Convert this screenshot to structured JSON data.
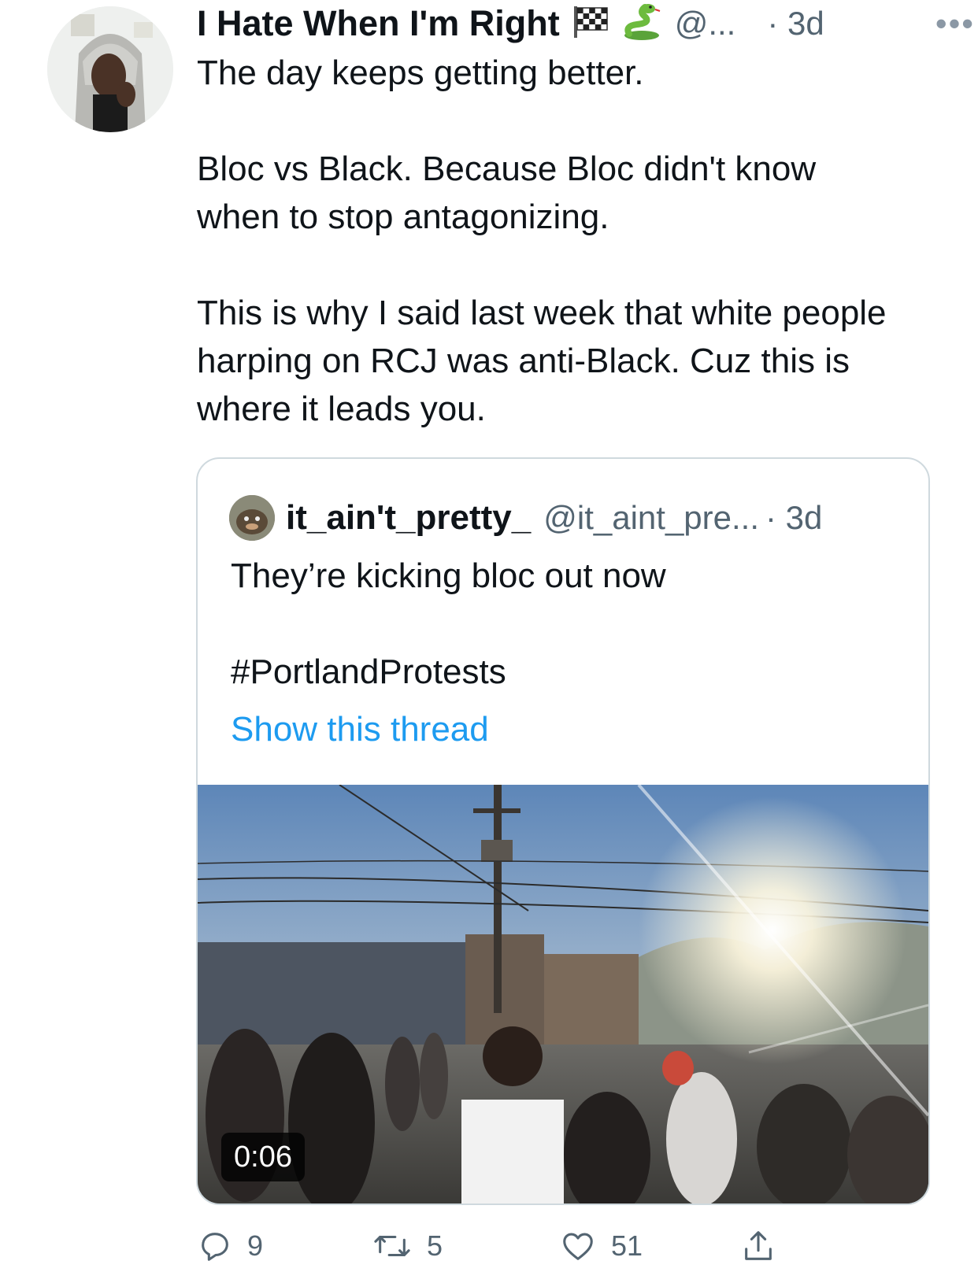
{
  "tweet": {
    "author_name": "I Hate When I'm Right",
    "author_emojis": [
      "checkered-flag-icon",
      "snake-icon"
    ],
    "handle": "@...",
    "time": "· 3d",
    "paragraphs": [
      "The day keeps getting better.",
      "Bloc vs Black. Because Bloc didn't know when to stop antagonizing.",
      "This is why I said last week that white people harping on RCJ was anti-Black. Cuz this is where it leads you."
    ],
    "more_icon": "more-icon"
  },
  "quoted_tweet": {
    "author_name": "it_ain't_pretty_",
    "handle": "@it_aint_pre...",
    "time": "· 3d",
    "text": "They’re kicking bloc out now",
    "hashtag": "#PortlandProtests",
    "show_thread": "Show this thread",
    "video_duration": "0:06"
  },
  "actions": {
    "reply_count": "9",
    "retweet_count": "5",
    "like_count": "51"
  },
  "colors": {
    "link": "#1d9bf0",
    "secondary_text": "#536471",
    "border": "#cfd9de"
  }
}
